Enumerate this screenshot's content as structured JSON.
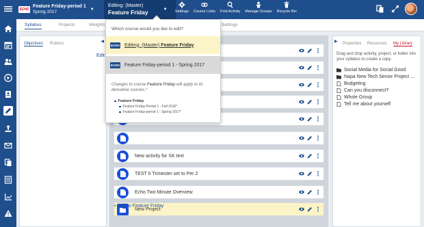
{
  "header": {
    "course_a": {
      "title": "Feature Friday-period 1",
      "term": "Spring 2017"
    },
    "course_b": {
      "title": "Editing: (Master)",
      "subtitle": "Feature Friday"
    },
    "tools": [
      {
        "label": "Settings",
        "icon": "gear-icon"
      },
      {
        "label": "Course Links",
        "icon": "link-icon"
      },
      {
        "label": "Find Activity",
        "icon": "search-icon"
      },
      {
        "label": "Manage Groups",
        "icon": "groups-icon"
      },
      {
        "label": "Recycle Bin",
        "icon": "trash-icon"
      }
    ],
    "logo_text": "ECHO",
    "colors": {
      "brand": "#1f4e8c",
      "accent": "#1a4fd8",
      "highlight": "#fcf4c7"
    }
  },
  "tabs": [
    "Syllabus",
    "Projects",
    "Weights",
    "Settings"
  ],
  "left_panel": {
    "tabs": [
      "Objectives",
      "Rubrics"
    ],
    "edit_label": "Edit"
  },
  "items": [
    {
      "label": "",
      "type": "doc"
    },
    {
      "label": "",
      "type": "doc"
    },
    {
      "label": "",
      "type": "doc"
    },
    {
      "label": "",
      "type": "doc"
    },
    {
      "label": "",
      "type": "doc"
    },
    {
      "label": "",
      "type": "doc"
    },
    {
      "label": "New activity for SK text",
      "type": "doc"
    },
    {
      "label": "TEST II Trimester set to Per 2",
      "type": "doc"
    },
    {
      "label": "Echo Two Minute Overview",
      "type": "doc"
    },
    {
      "label": "New Project",
      "type": "folder"
    }
  ],
  "add_label": "+ Add to Feature Friday",
  "right_panel": {
    "tabs": [
      "Properties",
      "Resources",
      "My Library"
    ],
    "description": "Drag and drop activity, project, or folder into your syllabus to create a copy.",
    "library": [
      {
        "label": "Social Media for Social Good",
        "kind": "folder"
      },
      {
        "label": "Napa New Tech Senior Project ...",
        "kind": "folder"
      },
      {
        "label": "Budgeting",
        "kind": "doc"
      },
      {
        "label": "Can you disconnect?",
        "kind": "doc"
      },
      {
        "label": "Whole Group",
        "kind": "doc"
      },
      {
        "label": "Tell me about yourself",
        "kind": "doc"
      }
    ]
  },
  "dropdown": {
    "question": "Which course would you like to edit?",
    "option1_prefix": "Editing: (Master) ",
    "option1_bold": "Feature Friday",
    "option2": "Feature Friday-period 1 - Spring 2017",
    "note_prefix": "Changes to course ",
    "note_bold": "Feature Friday",
    "note_suffix": " will apply to its derivative courses.*",
    "tree_root": "Feature Friday",
    "tree_children": [
      "Feature Friday-Period 1 - Fall 2016*",
      "Feature Friday-period 1 - Spring 2017*"
    ]
  }
}
